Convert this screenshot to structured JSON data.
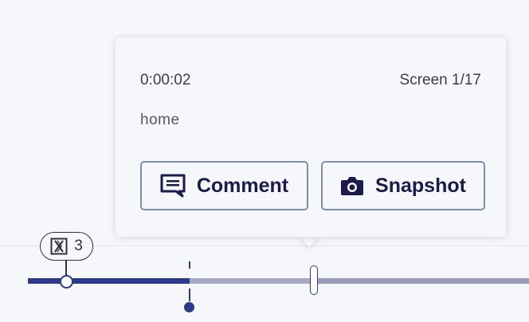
{
  "popover": {
    "timestamp": "0:00:02",
    "screen_count": "Screen 1/17",
    "page_name": "home",
    "comment_label": "Comment",
    "snapshot_label": "Snapshot",
    "comment_icon": "comment-icon",
    "snapshot_icon": "camera-icon"
  },
  "timeline": {
    "badge_icon": "logo-icon",
    "badge_count": "3",
    "colors": {
      "played": "#2d3a8c",
      "unplayed": "#aaa9c4",
      "button_text": "#1c1a4b",
      "button_border": "#7f8ea8"
    }
  }
}
